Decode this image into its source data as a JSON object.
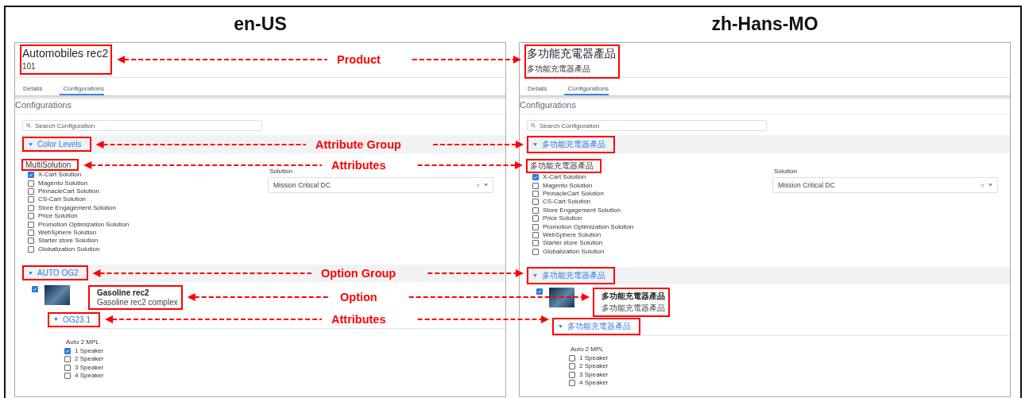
{
  "panels": [
    {
      "heading": "en-US",
      "product": {
        "name": "Automobiles rec2",
        "code": "101",
        "highlighted": true
      },
      "tabs": [
        {
          "label": "Details",
          "selected": false
        },
        {
          "label": "Configurations",
          "selected": true
        }
      ],
      "section_title": "Configurations",
      "search": {
        "placeholder": "Search Configuration"
      },
      "attribute_group": {
        "label": "Color Levels",
        "expanded": true,
        "highlighted": true
      },
      "attributes": [
        {
          "kind": "checklist",
          "label": "MultiSolution",
          "highlighted": true,
          "options": [
            {
              "label": "X-Cart Solution",
              "checked": true
            },
            {
              "label": "Magento Solution",
              "checked": false
            },
            {
              "label": "PinnacleCart Solution",
              "checked": false
            },
            {
              "label": "CS-Cart Solution",
              "checked": false
            },
            {
              "label": "Store Engagement Solution",
              "checked": false
            },
            {
              "label": "Price Solution",
              "checked": false
            },
            {
              "label": "Promotion Optimization Solution",
              "checked": false
            },
            {
              "label": "WebSphere Solution",
              "checked": false
            },
            {
              "label": "Starter store Solution",
              "checked": false
            },
            {
              "label": "Globalization Solution",
              "checked": false
            }
          ]
        },
        {
          "kind": "select",
          "label": "Solution",
          "value": "Mission Critical DC"
        }
      ],
      "option_group": {
        "label": "AUTO OG2",
        "expanded": true,
        "highlighted": true,
        "options": [
          {
            "checked": true,
            "name": "Gasoline rec2",
            "description": "Gasoline rec2 complex",
            "highlighted": true,
            "subgroup": {
              "label": "OG23.1",
              "expanded": true,
              "highlighted": true,
              "attribute": {
                "label": "Auto 2 MPL",
                "options": [
                  {
                    "label": "1 Speaker",
                    "checked": true
                  },
                  {
                    "label": "2 Speaker",
                    "checked": false
                  },
                  {
                    "label": "3 Speaker",
                    "checked": false
                  },
                  {
                    "label": "4 Speaker",
                    "checked": false
                  }
                ]
              }
            }
          }
        ]
      }
    },
    {
      "heading": "zh-Hans-MO",
      "product": {
        "name": "多功能充電器產品",
        "code": "多功能充電器產品",
        "highlighted": true
      },
      "tabs": [
        {
          "label": "Details",
          "selected": false
        },
        {
          "label": "Configurations",
          "selected": true
        }
      ],
      "section_title": "Configurations",
      "search": {
        "placeholder": "Search Configuration"
      },
      "attribute_group": {
        "label": "多功能充電器產品",
        "expanded": true,
        "highlighted": true
      },
      "attributes": [
        {
          "kind": "checklist",
          "label": "多功能充電器產品",
          "highlighted": true,
          "options": [
            {
              "label": "X-Cart Solution",
              "checked": true
            },
            {
              "label": "Magento Solution",
              "checked": false
            },
            {
              "label": "PinnacleCart Solution",
              "checked": false
            },
            {
              "label": "CS-Cart Solution",
              "checked": false
            },
            {
              "label": "Store Engagement Solution",
              "checked": false
            },
            {
              "label": "Price Solution",
              "checked": false
            },
            {
              "label": "Promotion Optimization Solution",
              "checked": false
            },
            {
              "label": "WebSphere Solution",
              "checked": false
            },
            {
              "label": "Starter store Solution",
              "checked": false
            },
            {
              "label": "Globalization Solution",
              "checked": false
            }
          ]
        },
        {
          "kind": "select",
          "label": "Solution",
          "value": "Mission Critical DC"
        }
      ],
      "option_group": {
        "label": "多功能充電器產品",
        "expanded": true,
        "highlighted": true,
        "options": [
          {
            "checked": true,
            "name": "多功能充電器產品",
            "description": "多功能充電器產品",
            "highlighted": true,
            "subgroup": {
              "label": "多功能充電器產品",
              "expanded": true,
              "highlighted": true,
              "attribute": {
                "label": "Auto 2 MPL",
                "options": [
                  {
                    "label": "1 Speaker",
                    "checked": false
                  },
                  {
                    "label": "2 Speaker",
                    "checked": false
                  },
                  {
                    "label": "3 Speaker",
                    "checked": false
                  },
                  {
                    "label": "4 Speaker",
                    "checked": false
                  }
                ]
              }
            }
          }
        ]
      }
    }
  ],
  "annotations": [
    {
      "label": "Product"
    },
    {
      "label": "Attribute Group"
    },
    {
      "label": "Attributes"
    },
    {
      "label": "Option Group"
    },
    {
      "label": "Option"
    },
    {
      "label": "Attributes"
    }
  ]
}
